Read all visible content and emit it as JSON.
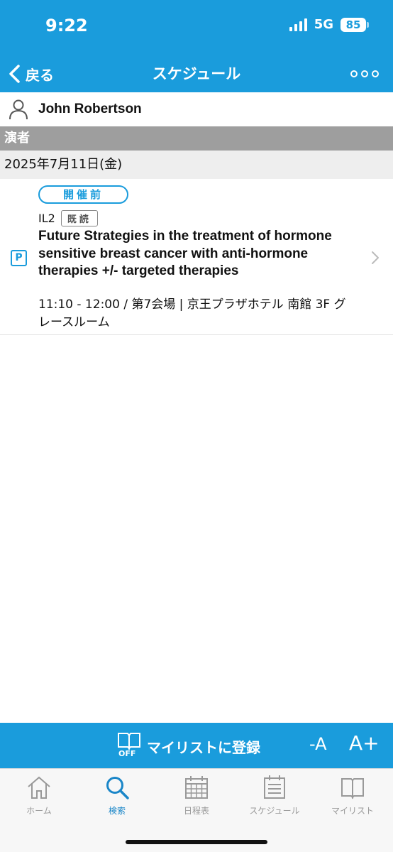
{
  "status_bar": {
    "time": "9:22",
    "network": "5G",
    "battery": "85"
  },
  "nav": {
    "back_label": "戻る",
    "title": "スケジュール",
    "more_icon": "ellipsis-circles-icon"
  },
  "person": {
    "name": "John Robertson",
    "icon": "person-outline-icon"
  },
  "section": {
    "header": "演者"
  },
  "date": "2025年7月11日(金)",
  "session": {
    "status": "開催前",
    "code": "IL2",
    "read_badge": "既読",
    "presentation_badge": "P",
    "title": "Future Strategies in the treatment of hormone sensitive breast cancer with anti-hormone therapies +/- targeted therapies",
    "meta": "11:10 - 12:00 / 第7会場 | 京王プラザホテル 南館 3F グレースルーム"
  },
  "action_bar": {
    "off_label": "OFF",
    "register_label": "マイリストに登録",
    "font_smaller": "-A",
    "font_larger": "A+"
  },
  "tabs": [
    {
      "label": "ホーム",
      "icon": "home-icon",
      "active": false
    },
    {
      "label": "検索",
      "icon": "search-icon",
      "active": true
    },
    {
      "label": "日程表",
      "icon": "calendar-grid-icon",
      "active": false
    },
    {
      "label": "スケジュール",
      "icon": "schedule-list-icon",
      "active": false
    },
    {
      "label": "マイリスト",
      "icon": "book-icon",
      "active": false
    }
  ],
  "colors": {
    "accent": "#1a9cdc",
    "section_header": "#9e9e9e",
    "date_row": "#eeeeee",
    "tab_active": "#1a86c8",
    "tab_inactive": "#999999"
  }
}
